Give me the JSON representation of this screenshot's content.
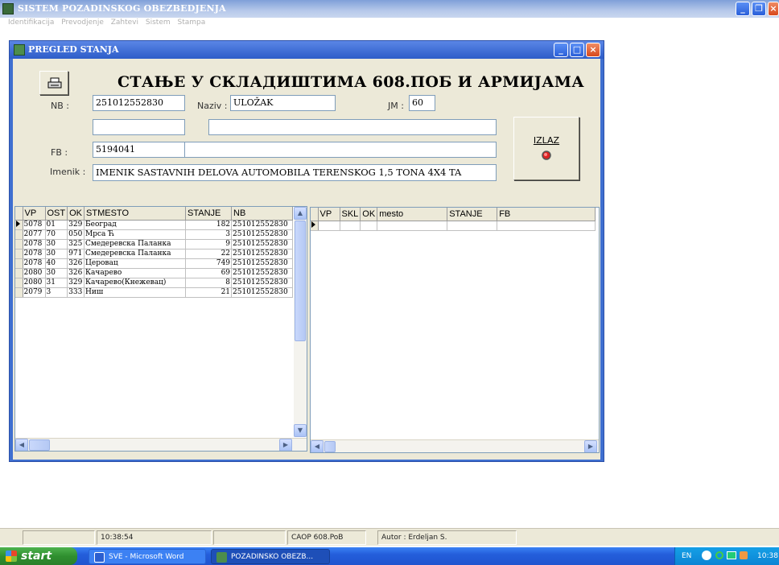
{
  "app": {
    "title": "SISTEM POZADINSKOG OBEZBEDJENJA",
    "menu": [
      "Identifikacija",
      "Prevodjenje",
      "Zahtevi",
      "Sistem",
      "Stampa"
    ]
  },
  "window": {
    "title": "PREGLED STANJA",
    "heading": "СТАЊЕ У СКЛАДИШТИМА 608.ПОБ И АРМИЈАМА",
    "fields": {
      "nb_label": "NB :",
      "nb_value": "251012552830",
      "naziv_label": "Naziv :",
      "naziv_value": "ULOŽAK",
      "jm_label": "JM :",
      "jm_value": "60",
      "extra1_value": "",
      "extra2_value": "",
      "fb_label": "FB :",
      "fb_value": "5194041",
      "fb_extra_value": "",
      "imenik_label": "Imenik :",
      "imenik_value": "IMENIK SASTAVNIH DELOVA AUTOMOBILA TERENSKOG 1,5 TONA 4X4 TA"
    },
    "buttons": {
      "print_icon": "printer-icon",
      "izlaz_label": "IZLAZ",
      "izlaz_icon": "red-dot-icon"
    },
    "left_grid": {
      "columns": [
        "VP",
        "OST",
        "OK",
        "STMESTO",
        "STANJE",
        "NB"
      ],
      "rows": [
        [
          "5078",
          "01",
          "329",
          "Београд",
          "182",
          "251012552830"
        ],
        [
          "2077",
          "70",
          "050",
          "Мрса Ћ",
          "3",
          "251012552830"
        ],
        [
          "2078",
          "30",
          "325",
          "Смедеревска Паланка",
          "9",
          "251012552830"
        ],
        [
          "2078",
          "30",
          "971",
          "Смедеревска Паланка",
          "22",
          "251012552830"
        ],
        [
          "2078",
          "40",
          "326",
          "Церовац",
          "749",
          "251012552830"
        ],
        [
          "2080",
          "30",
          "326",
          "Качарево",
          "69",
          "251012552830"
        ],
        [
          "2080",
          "31",
          "329",
          "Качарево(Кнежевац)",
          "8",
          "251012552830"
        ],
        [
          "2079",
          "3",
          "333",
          "Ниш",
          "21",
          "251012552830"
        ]
      ]
    },
    "right_grid": {
      "columns": [
        "VP",
        "SKL",
        "OK",
        "mesto",
        "STANJE",
        "FB"
      ]
    }
  },
  "statusbar": {
    "time": "10:38:54",
    "caop": "CAOP 608.PoB",
    "author": "Autor : Erdeljan S."
  },
  "taskbar": {
    "start": "start",
    "tasks": [
      "SVE - Microsoft Word",
      "POZADINSKO OBEZB..."
    ],
    "lang": "EN",
    "clock": "10:38"
  }
}
